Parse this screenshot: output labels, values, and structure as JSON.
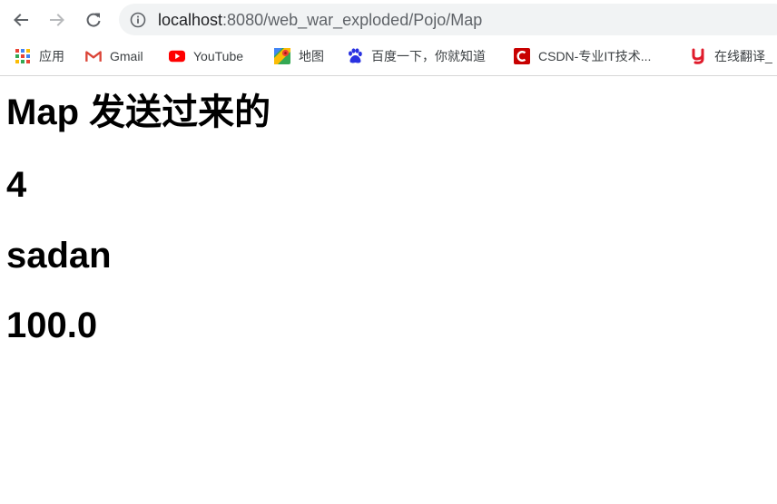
{
  "browser": {
    "url_host": "localhost",
    "url_rest": ":8080/web_war_exploded/Pojo/Map"
  },
  "bookmarks": [
    {
      "label": "应用",
      "icon": "apps-grid-icon"
    },
    {
      "label": "Gmail",
      "icon": "gmail-icon"
    },
    {
      "label": "YouTube",
      "icon": "youtube-icon"
    },
    {
      "label": "地图",
      "icon": "maps-icon"
    },
    {
      "label": "百度一下，你就知道",
      "icon": "baidu-paw-icon"
    },
    {
      "label": "CSDN-专业IT技术...",
      "icon": "csdn-icon"
    },
    {
      "label": "在线翻译_",
      "icon": "youdao-icon"
    }
  ],
  "page": {
    "heading": "Map 发送过来的",
    "values": [
      "4",
      "sadan",
      "100.0"
    ]
  },
  "colors": {
    "omnibox_bg": "#f1f3f4",
    "youtube_red": "#ff0000",
    "csdn_red": "#c80000",
    "youdao_red": "#e01b2b",
    "baidu_blue": "#2932e1"
  }
}
